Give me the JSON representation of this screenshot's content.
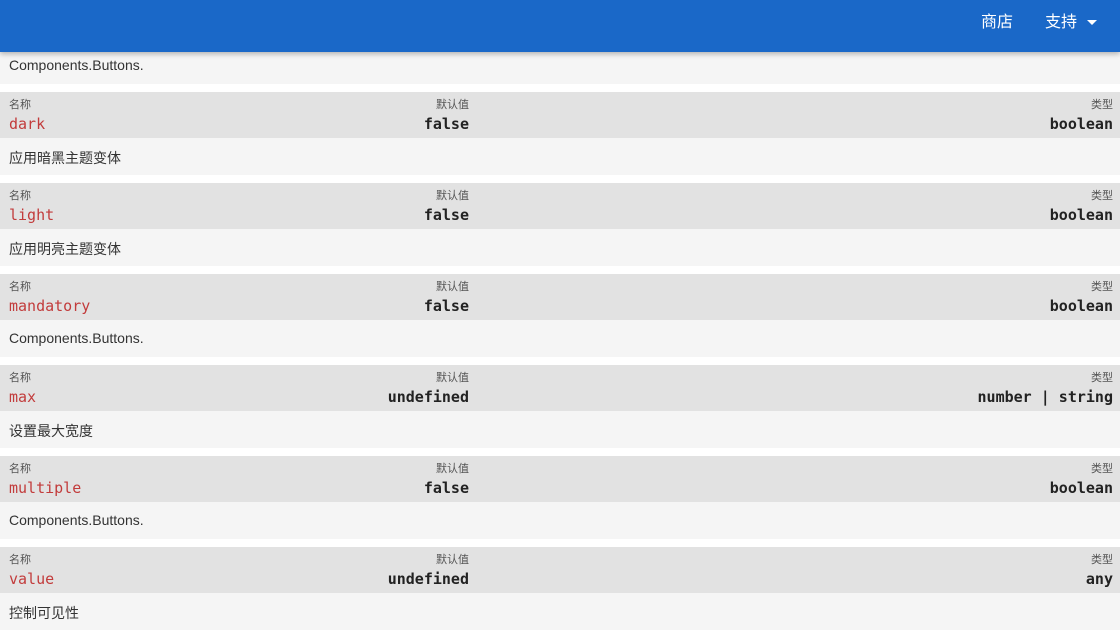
{
  "header": {
    "store_label": "商店",
    "support_label": "支持"
  },
  "top_description": "Components.Buttons.",
  "labels": {
    "name": "名称",
    "default": "默认值",
    "type": "类型"
  },
  "props": [
    {
      "name": "dark",
      "default": "false",
      "type": "boolean",
      "description": "应用暗黑主题变体"
    },
    {
      "name": "light",
      "default": "false",
      "type": "boolean",
      "description": "应用明亮主题变体"
    },
    {
      "name": "mandatory",
      "default": "false",
      "type": "boolean",
      "description": "Components.Buttons."
    },
    {
      "name": "max",
      "default": "undefined",
      "type": "number | string",
      "description": "设置最大宽度"
    },
    {
      "name": "multiple",
      "default": "false",
      "type": "boolean",
      "description": "Components.Buttons."
    },
    {
      "name": "value",
      "default": "undefined",
      "type": "any",
      "description": "控制可见性"
    }
  ]
}
